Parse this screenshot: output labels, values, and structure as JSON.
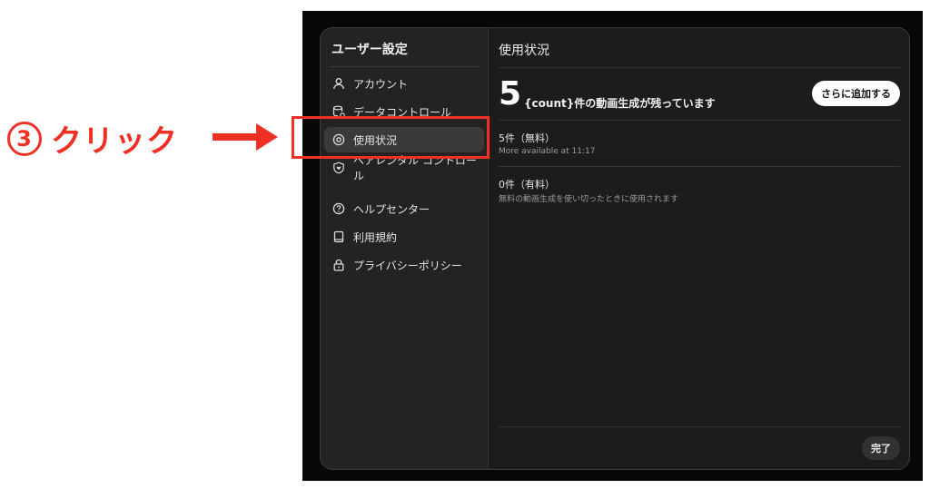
{
  "annotation": {
    "step_number": "3",
    "label": "クリック",
    "color": "#ee3124"
  },
  "sidebar": {
    "title": "ユーザー設定",
    "items": [
      {
        "label": "アカウント",
        "icon": "person-icon"
      },
      {
        "label": "データコントロール",
        "icon": "database-icon"
      },
      {
        "label": "使用状況",
        "icon": "target-icon",
        "active": true
      },
      {
        "label": "ペアレンタル コントロール",
        "icon": "shield-heart-icon"
      },
      {
        "label": "ヘルプセンター",
        "icon": "help-circle-icon"
      },
      {
        "label": "利用規約",
        "icon": "book-icon"
      },
      {
        "label": "プライバシーポリシー",
        "icon": "lock-icon"
      }
    ]
  },
  "content": {
    "title": "使用状況",
    "count": "5",
    "remaining_text": "{count}件の動画生成が残っています",
    "add_more_label": "さらに追加する",
    "rows": [
      {
        "title": "5件（無料）",
        "subtitle": "More available at 11:17"
      },
      {
        "title": "0件（有料）",
        "subtitle": "無料の動画生成を使い切ったときに使用されます"
      }
    ],
    "done_label": "完了"
  }
}
